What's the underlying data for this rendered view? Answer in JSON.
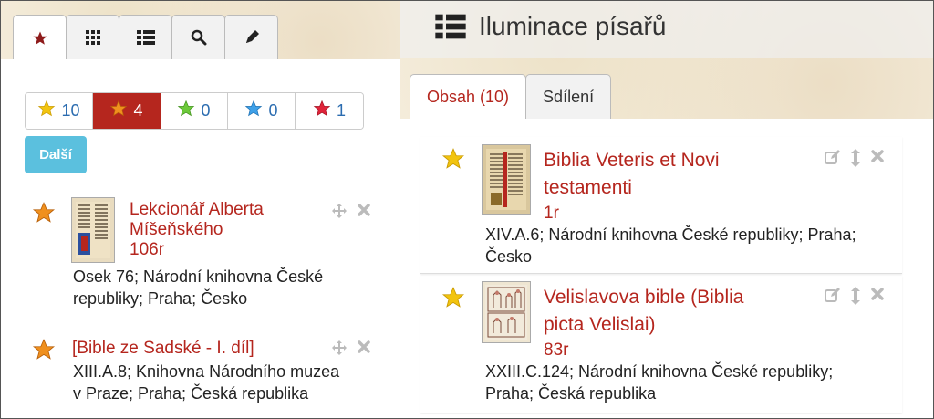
{
  "left": {
    "tabs": [
      {
        "icon": "star-icon"
      },
      {
        "icon": "grid-icon"
      },
      {
        "icon": "list-icon"
      },
      {
        "icon": "search-icon"
      },
      {
        "icon": "pencil-icon"
      }
    ],
    "filters": [
      {
        "icon": "star-yellow-icon",
        "color": "#f2c40f",
        "count": "10"
      },
      {
        "icon": "star-orange-icon",
        "color": "#f0901e",
        "count": "4"
      },
      {
        "icon": "star-green-icon",
        "color": "#6cc93a",
        "count": "0"
      },
      {
        "icon": "star-blue-icon",
        "color": "#3ea0e8",
        "count": "0"
      },
      {
        "icon": "star-red-icon",
        "color": "#e0243a",
        "count": "1"
      }
    ],
    "more_button": "Další",
    "items": [
      {
        "title_line1": "Lekcionář Alberta",
        "title_line2": "Míšeňského",
        "folio": "106r",
        "meta_line1": "Osek 76; Národní knihovna České",
        "meta_line2": "republiky; Praha; Česko"
      },
      {
        "title_line1": "[Bible ze Sadské - I. díl]",
        "meta_line1": "XIII.A.8; Knihovna Národního muzea",
        "meta_line2": "v Praze; Praha; Česká republika"
      }
    ]
  },
  "right": {
    "title": "Iluminace písařů",
    "tabs": [
      {
        "label": "Obsah (10)"
      },
      {
        "label": "Sdílení"
      }
    ],
    "items": [
      {
        "title_line1": "Biblia Veteris et Novi",
        "title_line2": "testamenti",
        "folio": "1r",
        "meta_line1": "XIV.A.6; Národní knihovna České republiky; Praha;",
        "meta_line2": "Česko"
      },
      {
        "title_line1": "Velislavova bible (Biblia",
        "title_line2": "picta Velislai)",
        "folio": "83r",
        "meta_line1": "XXIII.C.124; Národní knihovna České republiky;",
        "meta_line2": "Praha; Česká republika"
      }
    ]
  },
  "colors": {
    "accent": "#b5261e",
    "info_button": "#5bc0de",
    "link": "#2b6cb0"
  }
}
